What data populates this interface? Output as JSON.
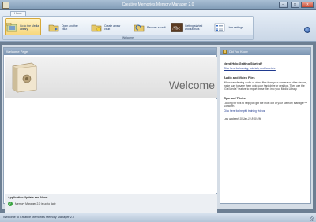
{
  "window": {
    "title": "Creative Memories Memory Manager 2.0",
    "minimize": "–",
    "maximize": "□",
    "close": "✕"
  },
  "ribbon": {
    "tab": "Home",
    "group_label": "Welcome",
    "items": [
      {
        "label": "Go to the Media Library",
        "icon": "media-library-icon"
      },
      {
        "label": "Open another vault",
        "icon": "open-vault-icon"
      },
      {
        "label": "Create a new vault",
        "icon": "create-vault-icon"
      },
      {
        "label": "Recover a vault",
        "icon": "recover-vault-icon"
      },
      {
        "label": "Getting started and tutorials",
        "icon": "abc-tutorial-icon"
      },
      {
        "label": "User settings",
        "icon": "settings-icon"
      }
    ]
  },
  "left_pane": {
    "header": "Welcome Page",
    "welcome_text": "Welcome",
    "update_title": "Application Update and News",
    "update_status": "Memory Manager 2.0 is up to date"
  },
  "right_pane": {
    "header": "Did You Know",
    "sections": [
      {
        "title": "Need Help Getting Started?",
        "text": "",
        "link": "Click here for training, tutorials, and how-to's."
      },
      {
        "title": "Audio and Video Files",
        "text": "When transferring audio or video files from your camera or other device, make sure to save them onto your hard drive or desktop. Then use the \"Get Media\" feature to import these files into your Media Library.",
        "link": ""
      },
      {
        "title": "Tips and Tricks",
        "text": "Looking for tips to help you get the most out of your Memory Manager™ Software?",
        "link": "Click here for helpful training videos."
      }
    ],
    "last_updated": "Last updated: 10-Jan-10 8:50 PM"
  },
  "status": {
    "text": "Welcome to Creative Memories Memory Manager 2.0"
  },
  "colors": {
    "accent": "#1f3a66",
    "success": "#3aa441"
  }
}
